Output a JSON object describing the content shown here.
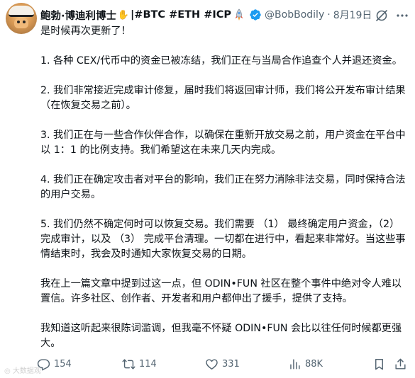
{
  "post": {
    "author_name": "鲍勃·博迪利博士",
    "author_tags": "|#BTC #ETH #ICP",
    "handle": "@BobBodily",
    "separator": "·",
    "date": "8月19日",
    "paragraphs": [
      "是时候再次更新了！",
      "1. 各种 CEX/代币中的资金已被冻结，我们正在与当局合作追查个人并退还资金。",
      "2. 我们非常接近完成审计修复，届时我们将返回审计师，我们将公开发布审计结果（在恢复交易之前）。",
      "3. 我们正在与一些合作伙伴合作，以确保在重新开放交易之前，用户资金在平台中以 1：1 的比例支持。我们希望这在未来几天内完成。",
      "4. 我们正在确定攻击者对平台的影响，我们正在努力消除非法交易，同时保持合法的用户交易。",
      "5. 我们仍然不确定何时可以恢复交易。我们需要 （1） 最终确定用户资金，（2） 完成审计，以及 （3） 完成平台清理。一切都在进行中，看起来非常好。当这些事情结束时，我会及时通知大家恢复交易的日期。",
      "我在上一篇文章中提到过这一点，但 ODIN•FUN 社区在整个事件中绝对令人难以置信。许多社区、创作者、开发者和用户都伸出了援手，提供了支持。",
      "我知道这听起来很陈词滥调，但我毫不怀疑 ODIN•FUN 会比以往任何时候都更强大。"
    ]
  },
  "actions": {
    "replies": "154",
    "reposts": "114",
    "likes": "331",
    "views": "88K"
  },
  "watermark": "大数据观",
  "colors": {
    "verified": "#1d9bf0",
    "muted": "#536471",
    "text": "#0f1419"
  }
}
